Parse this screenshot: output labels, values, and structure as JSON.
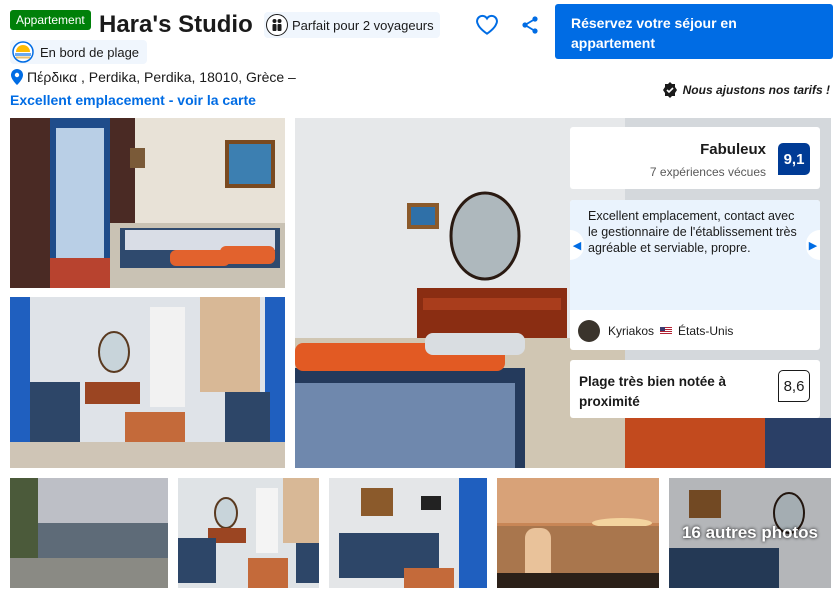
{
  "header": {
    "type_badge": "Appartement",
    "title": "Hara's Studio",
    "travelers_pill": "Parfait pour 2 voyageurs",
    "cta_label": "Réservez votre séjour en appartement",
    "beach_badge": "En bord de plage",
    "address": "Πέρδικα , Perdika, Perdika, 18010, Grèce –",
    "location_link": "Excellent emplacement - voir la carte",
    "price_match": "Nous ajustons nos tarifs !"
  },
  "rating": {
    "label": "Fabuleux",
    "reviews": "7 expériences vécues",
    "score": "9,1"
  },
  "review": {
    "text": "Excellent emplacement, contact avec le gestionnaire de l'établissement très agréable et serviable, propre.",
    "author": "Kyriakos",
    "country": "États-Unis"
  },
  "beach_rating": {
    "label": "Plage très bien notée à proximité",
    "score": "8,6"
  },
  "gallery": {
    "more_photos": "16 autres photos"
  },
  "colors": {
    "brand_blue": "#006ce4",
    "dark_blue": "#003b95",
    "green_badge": "#008009"
  }
}
